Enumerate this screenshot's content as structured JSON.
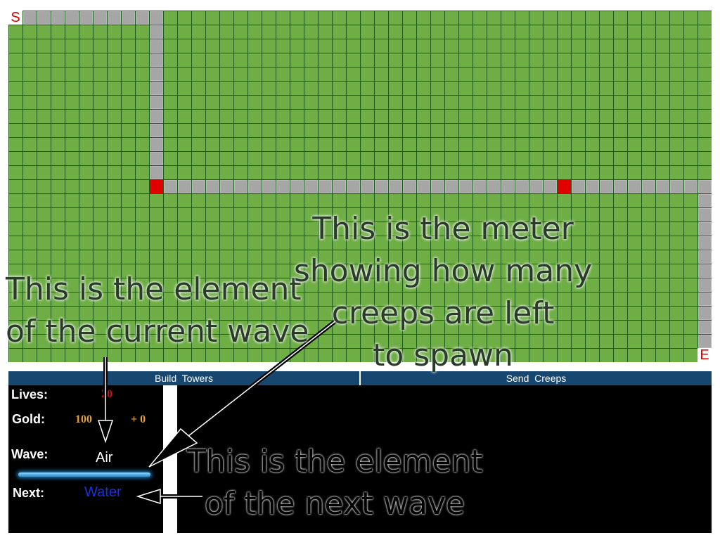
{
  "board": {
    "start_label": "S",
    "end_label": "E",
    "path_color": "#a6a6a6",
    "grass_color": "#6fae45",
    "grid_color": "#1d5a1d"
  },
  "tabs": {
    "build_towers": "Build  Towers",
    "send_creeps": "Send  Creeps"
  },
  "stats": {
    "lives_label": "Lives:",
    "lives_value": "20",
    "gold_label": "Gold:",
    "gold_value": "100",
    "gold_income": "+ 0",
    "wave_label": "Wave:",
    "wave_value": "Air",
    "next_label": "Next:",
    "next_value": "Water",
    "spawn_meter_fraction": 1.0
  },
  "annotations": {
    "current_element": "This is the element\nof the current wave",
    "meter": "This is the meter\nshowing how many\ncreeps are left\nto spawn",
    "next_element": "This is the element\nof the next wave"
  },
  "colors": {
    "lives": "#cc1111",
    "gold": "#e0a23a",
    "next": "#1f2fd8",
    "tab_bg": "#17476f",
    "meter": "#2a8cd0"
  }
}
